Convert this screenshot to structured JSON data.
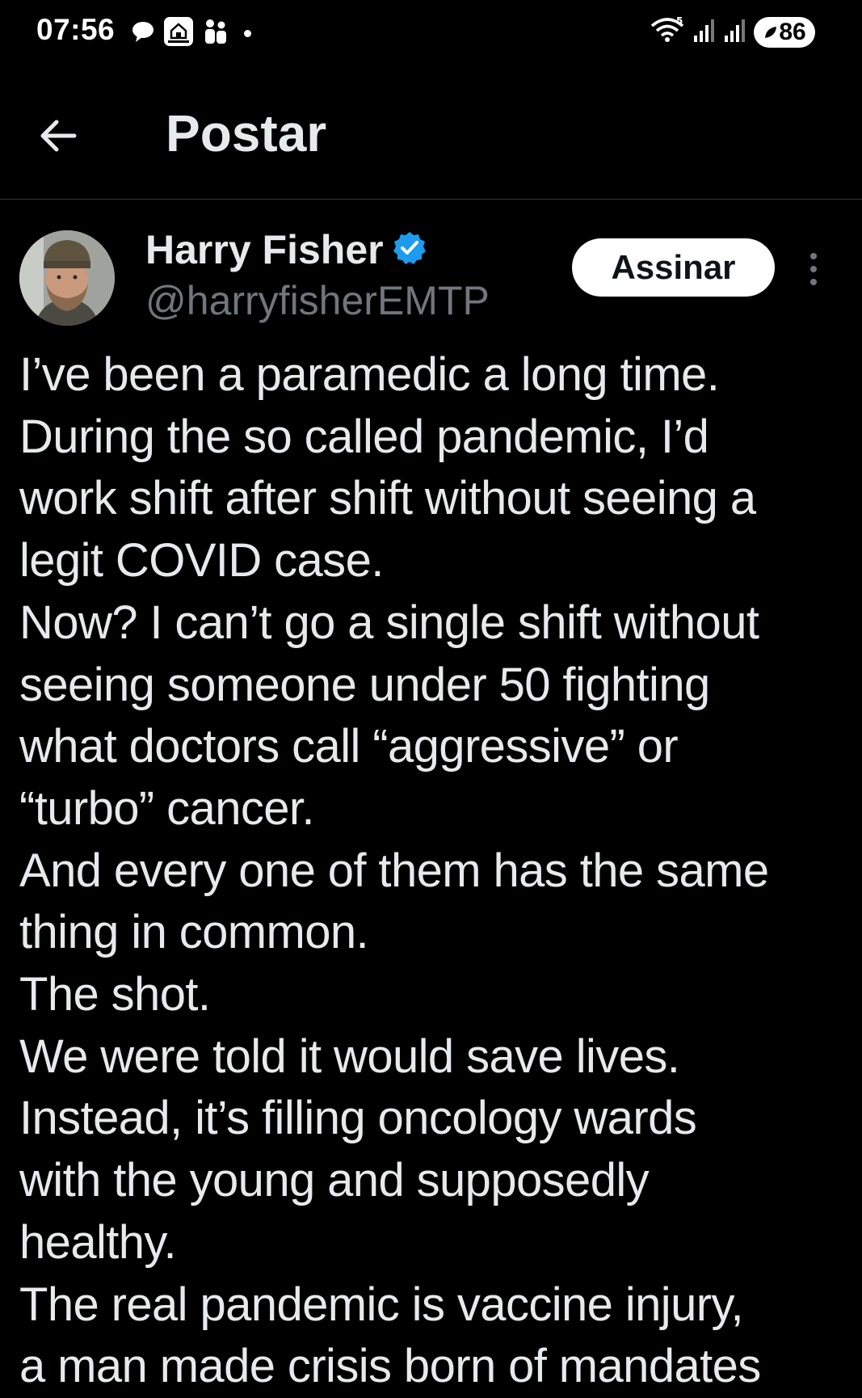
{
  "status_bar": {
    "time": "07:56",
    "battery": "86"
  },
  "header": {
    "title": "Postar"
  },
  "author": {
    "name": "Harry Fisher",
    "handle": "@harryfisherEMTP",
    "verified": true,
    "subscribe_label": "Assinar"
  },
  "post": {
    "lines": [
      "I’ve been a paramedic a long time.",
      "During the so called pandemic, I’d",
      "work shift after shift without seeing a",
      "legit COVID case.",
      "Now? I can’t go a single shift without",
      "seeing someone under 50 fighting",
      "what doctors call “aggressive” or",
      "“turbo” cancer.",
      "And every one of them has the same",
      "thing in common.",
      "The shot.",
      "We were told it would save lives.",
      "Instead, it’s filling oncology wards",
      "with the young and supposedly",
      "healthy.",
      "The real pandemic is vaccine injury,",
      "a man made crisis born of mandates"
    ]
  },
  "colors": {
    "background": "#000000",
    "text": "#e7e9ea",
    "secondary_text": "#71767b",
    "verified_badge": "#1d9bf0"
  }
}
